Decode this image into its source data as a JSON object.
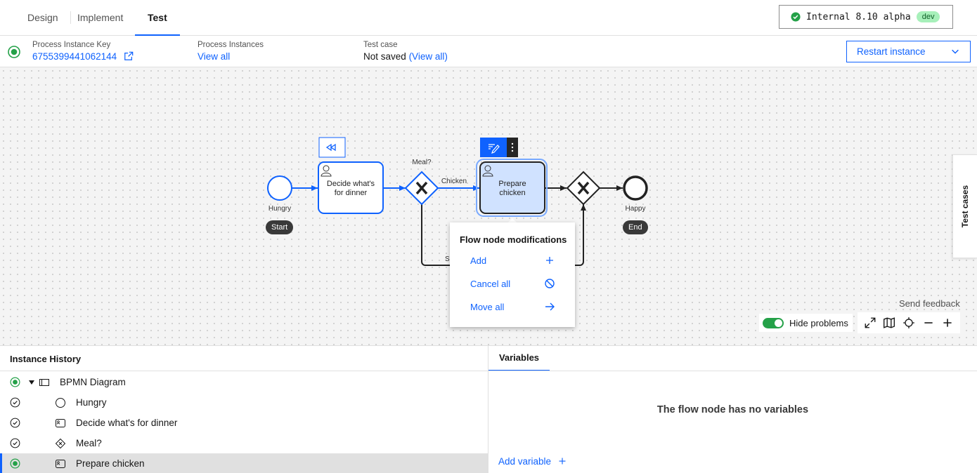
{
  "tabs": [
    {
      "label": "Design",
      "active": false
    },
    {
      "label": "Implement",
      "active": false
    },
    {
      "label": "Test",
      "active": true
    }
  ],
  "cluster": {
    "label": "Internal 8.10 alpha",
    "badge": "dev"
  },
  "instance": {
    "key_label": "Process Instance Key",
    "key_value": "6755399441062144",
    "instances_label": "Process Instances",
    "instances_link": "View all",
    "testcase_label": "Test case",
    "testcase_value": "Not saved",
    "testcase_link": "(View all)",
    "restart_label": "Restart instance"
  },
  "diagram": {
    "start_event": "Hungry",
    "start_pill": "Start",
    "task1": [
      "Decide what's",
      "for dinner"
    ],
    "gateway1": "Meal?",
    "flow_chicken": "Chicken",
    "flow_partial": "S",
    "task2": [
      "Prepare",
      "chicken"
    ],
    "end_event": "Happy",
    "end_pill": "End"
  },
  "popover": {
    "title": "Flow node modifications",
    "items": [
      "Add",
      "Cancel all",
      "Move all"
    ]
  },
  "side": {
    "test_cases": "Test cases"
  },
  "canvas_tools": {
    "feedback": "Send feedback",
    "hide_problems": "Hide problems"
  },
  "history": {
    "title": "Instance History",
    "rows": [
      {
        "label": "BPMN Diagram",
        "status": "active"
      },
      {
        "label": "Hungry",
        "status": "completed"
      },
      {
        "label": "Decide what's for dinner",
        "status": "completed"
      },
      {
        "label": "Meal?",
        "status": "completed"
      },
      {
        "label": "Prepare chicken",
        "status": "active"
      }
    ]
  },
  "variables": {
    "tab": "Variables",
    "empty": "The flow node has no variables",
    "add": "Add variable"
  },
  "colors": {
    "accent": "#0f62fe",
    "success": "#24a148",
    "selected_task": "#d0e2ff"
  }
}
